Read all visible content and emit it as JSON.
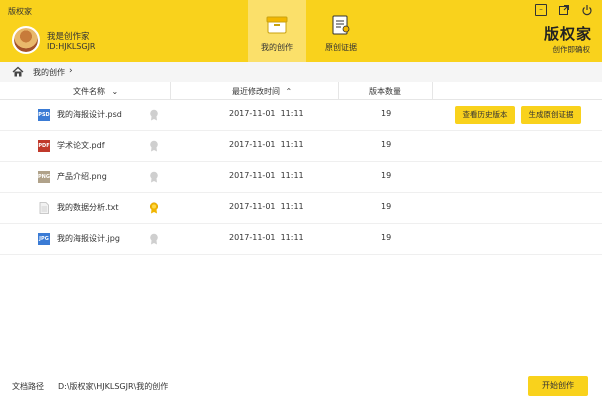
{
  "header": {
    "app_title": "版权家",
    "user_name": "我是创作家",
    "user_id": "ID:HJKLSGJR",
    "tabs": [
      {
        "label": "我的创作"
      },
      {
        "label": "原创证据"
      }
    ],
    "brand": "版权家",
    "brand_sub": "创作即确权",
    "accent_color": "#f9d21c"
  },
  "breadcrumb": {
    "label": "我的创作",
    "chevron": "›"
  },
  "table": {
    "columns": {
      "file_name": "文件名称",
      "modified": "最近修改时间",
      "version_count": "版本数量"
    },
    "rows": [
      {
        "name": "我的海报设计.psd",
        "icon": "PSD",
        "icon_color": "#3a7bd5",
        "date": "2017-11-01",
        "time": "11:11",
        "count": "19",
        "cert": "gray"
      },
      {
        "name": "学术论文.pdf",
        "icon": "PDF",
        "icon_color": "#c0392b",
        "date": "2017-11-01",
        "time": "11:11",
        "count": "19",
        "cert": "gray"
      },
      {
        "name": "产品介绍.png",
        "icon": "PNG",
        "icon_color": "#b0a28a",
        "date": "2017-11-01",
        "time": "11:11",
        "count": "19",
        "cert": "gray"
      },
      {
        "name": "我的数据分析.txt",
        "icon": "",
        "icon_color": "#dcdcdc",
        "date": "2017-11-01",
        "time": "11:11",
        "count": "19",
        "cert": "gold"
      },
      {
        "name": "我的海报设计.jpg",
        "icon": "JPG",
        "icon_color": "#3a7bd5",
        "date": "2017-11-01",
        "time": "11:11",
        "count": "19",
        "cert": "gray"
      }
    ],
    "row_actions": {
      "history": "查看历史版本",
      "certificate": "生成原创证据"
    }
  },
  "footer": {
    "path_label": "文档路径",
    "path_value": "D:\\版权家\\HJKLSGJR\\我的创作",
    "start_button": "开始创作"
  }
}
